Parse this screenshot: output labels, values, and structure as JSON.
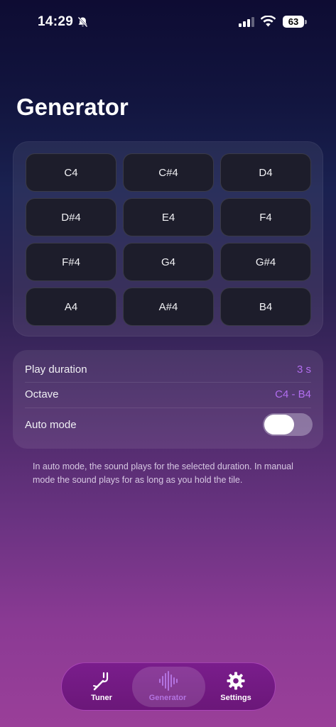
{
  "status_bar": {
    "time": "14:29",
    "battery": "63",
    "icons": [
      "bell-slash-icon",
      "cellular-signal-icon",
      "wifi-icon",
      "battery-icon"
    ]
  },
  "page": {
    "title": "Generator"
  },
  "notes": [
    {
      "label": "C4"
    },
    {
      "label": "C#4"
    },
    {
      "label": "D4"
    },
    {
      "label": "D#4"
    },
    {
      "label": "E4"
    },
    {
      "label": "F4"
    },
    {
      "label": "F#4"
    },
    {
      "label": "G4"
    },
    {
      "label": "G#4"
    },
    {
      "label": "A4"
    },
    {
      "label": "A#4"
    },
    {
      "label": "B4"
    }
  ],
  "settings": {
    "play_duration_label": "Play duration",
    "play_duration_value": "3 s",
    "octave_label": "Octave",
    "octave_value": "C4 - B4",
    "auto_mode_label": "Auto mode",
    "auto_mode_on": false
  },
  "help_text": "In auto mode, the sound plays for the selected  duration. In manual mode the sound plays for as long as you hold the tile.",
  "tab_bar": {
    "tabs": [
      {
        "label": "Tuner",
        "icon": "tuning-fork-icon"
      },
      {
        "label": "Generator",
        "icon": "waveform-icon",
        "active": true
      },
      {
        "label": "Settings",
        "icon": "gear-icon"
      }
    ]
  },
  "colors": {
    "accent": "#b26ef0",
    "tab_bar": "#761b88",
    "tile": "#1d1d2b"
  }
}
